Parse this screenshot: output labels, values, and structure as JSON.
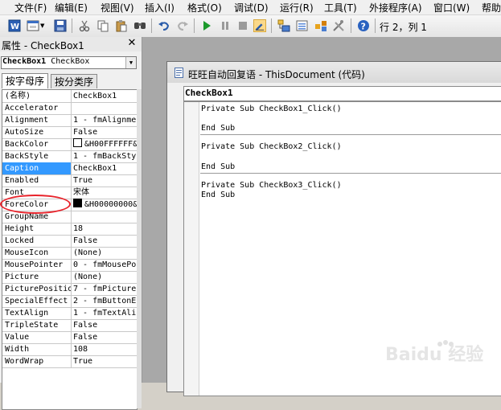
{
  "menubar": {
    "items": [
      "文件(F)",
      "编辑(E)",
      "视图(V)",
      "插入(I)",
      "格式(O)",
      "调试(D)",
      "运行(R)",
      "工具(T)",
      "外接程序(A)",
      "窗口(W)",
      "帮助"
    ]
  },
  "toolbar": {
    "position_text": "行 2，列 1"
  },
  "properties": {
    "title": "属性 - CheckBox1",
    "object_name": "CheckBox1",
    "object_type": "CheckBox",
    "tabs": [
      "按字母序",
      "按分类序"
    ],
    "rows": [
      {
        "name": "(名称)",
        "value": "CheckBox1"
      },
      {
        "name": "Accelerator",
        "value": ""
      },
      {
        "name": "Alignment",
        "value": "1 - fmAlignme"
      },
      {
        "name": "AutoSize",
        "value": "False"
      },
      {
        "name": "BackColor",
        "value": "&H00FFFFFF&",
        "swatch": "#ffffff"
      },
      {
        "name": "BackStyle",
        "value": "1 - fmBackSty"
      },
      {
        "name": "Caption",
        "value": "CheckBox1"
      },
      {
        "name": "Enabled",
        "value": "True"
      },
      {
        "name": "Font",
        "value": "宋体"
      },
      {
        "name": "ForeColor",
        "value": "&H00000000&",
        "swatch": "#000000"
      },
      {
        "name": "GroupName",
        "value": ""
      },
      {
        "name": "Height",
        "value": "18"
      },
      {
        "name": "Locked",
        "value": "False"
      },
      {
        "name": "MouseIcon",
        "value": "(None)"
      },
      {
        "name": "MousePointer",
        "value": "0 - fmMousePo"
      },
      {
        "name": "Picture",
        "value": "(None)"
      },
      {
        "name": "PicturePosition",
        "value": "7 - fmPicture"
      },
      {
        "name": "SpecialEffect",
        "value": "2 - fmButtonE"
      },
      {
        "name": "TextAlign",
        "value": "1 - fmTextAli"
      },
      {
        "name": "TripleState",
        "value": "False"
      },
      {
        "name": "Value",
        "value": "False"
      },
      {
        "name": "Width",
        "value": "108"
      },
      {
        "name": "WordWrap",
        "value": "True"
      }
    ],
    "selected_row": "Caption"
  },
  "code_window": {
    "title": "旺旺自动回复语 - ThisDocument (代码)",
    "object_box": "CheckBox1",
    "lines": [
      "Private Sub CheckBox1_Click()",
      "End Sub",
      "Private Sub CheckBox2_Click()",
      "End Sub",
      "Private Sub CheckBox3_Click()",
      "End Sub"
    ]
  },
  "watermark": {
    "text": "Baidu 经验"
  },
  "colors": {
    "selection": "#3399ff",
    "highlight_circle": "#e8232b",
    "accent_blue": "#1f5fbf"
  }
}
